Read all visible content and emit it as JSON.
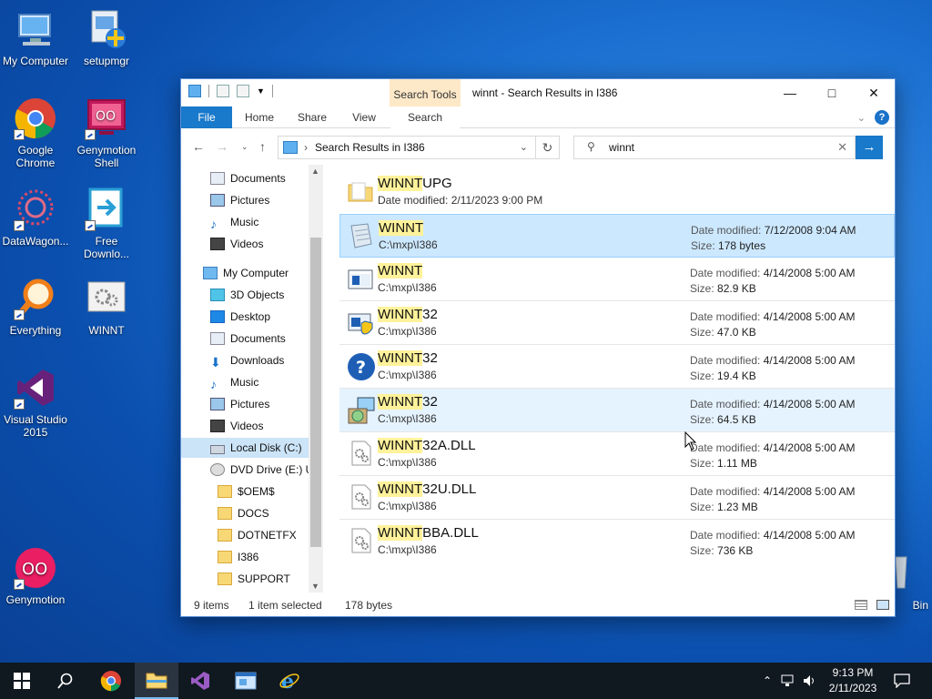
{
  "desktop": {
    "icons": [
      {
        "label": "My Computer"
      },
      {
        "label": "setupmgr"
      },
      {
        "label": "Google Chrome"
      },
      {
        "label": "Genymotion Shell"
      },
      {
        "label": "DataWagon..."
      },
      {
        "label": "Free Downlo..."
      },
      {
        "label": "Everything"
      },
      {
        "label": "WINNT"
      },
      {
        "label": "Visual Studio 2015"
      },
      {
        "label": "Genymotion"
      },
      {
        "label": "Bin"
      }
    ]
  },
  "window": {
    "title": "winnt - Search Results in I386",
    "contextual_tab": "Search Tools",
    "ribbon_tabs": [
      "File",
      "Home",
      "Share",
      "View",
      "Search"
    ],
    "address": {
      "crumb": "Search Results in I386"
    },
    "search": {
      "value": "winnt"
    },
    "nav": [
      {
        "label": "Documents",
        "pinned": true
      },
      {
        "label": "Pictures",
        "pinned": true
      },
      {
        "label": "Music"
      },
      {
        "label": "Videos"
      },
      {
        "label": "My Computer"
      },
      {
        "label": "3D Objects"
      },
      {
        "label": "Desktop"
      },
      {
        "label": "Documents"
      },
      {
        "label": "Downloads"
      },
      {
        "label": "Music"
      },
      {
        "label": "Pictures"
      },
      {
        "label": "Videos"
      },
      {
        "label": "Local Disk (C:)"
      },
      {
        "label": "DVD Drive (E:) UI"
      },
      {
        "label": "$OEM$"
      },
      {
        "label": "DOCS"
      },
      {
        "label": "DOTNETFX"
      },
      {
        "label": "I386"
      },
      {
        "label": "SUPPORT"
      }
    ],
    "results": [
      {
        "hl": "WINNT",
        "rest": "UPG",
        "line2": "Date modified: 2/11/2023 9:00 PM",
        "mod_label": "",
        "mod": "",
        "size_label": "",
        "size": ""
      },
      {
        "hl": "WINNT",
        "rest": "",
        "line2": "C:\\mxp\\I386",
        "mod_label": "Date modified:",
        "mod": "7/12/2008 9:04 AM",
        "size_label": "Size:",
        "size": "178 bytes"
      },
      {
        "hl": "WINNT",
        "rest": "",
        "line2": "C:\\mxp\\I386",
        "mod_label": "Date modified:",
        "mod": "4/14/2008 5:00 AM",
        "size_label": "Size:",
        "size": "82.9 KB"
      },
      {
        "hl": "WINNT",
        "rest": "32",
        "line2": "C:\\mxp\\I386",
        "mod_label": "Date modified:",
        "mod": "4/14/2008 5:00 AM",
        "size_label": "Size:",
        "size": "47.0 KB"
      },
      {
        "hl": "WINNT",
        "rest": "32",
        "line2": "C:\\mxp\\I386",
        "mod_label": "Date modified:",
        "mod": "4/14/2008 5:00 AM",
        "size_label": "Size:",
        "size": "19.4 KB"
      },
      {
        "hl": "WINNT",
        "rest": "32",
        "line2": "C:\\mxp\\I386",
        "mod_label": "Date modified:",
        "mod": "4/14/2008 5:00 AM",
        "size_label": "Size:",
        "size": "64.5 KB"
      },
      {
        "hl": "WINNT",
        "rest": "32A.DLL",
        "line2": "C:\\mxp\\I386",
        "mod_label": "Date modified:",
        "mod": "4/14/2008 5:00 AM",
        "size_label": "Size:",
        "size": "1.11 MB"
      },
      {
        "hl": "WINNT",
        "rest": "32U.DLL",
        "line2": "C:\\mxp\\I386",
        "mod_label": "Date modified:",
        "mod": "4/14/2008 5:00 AM",
        "size_label": "Size:",
        "size": "1.23 MB"
      },
      {
        "hl": "WINNT",
        "rest": "BBA.DLL",
        "line2": "C:\\mxp\\I386",
        "mod_label": "Date modified:",
        "mod": "4/14/2008 5:00 AM",
        "size_label": "Size:",
        "size": "736 KB"
      }
    ],
    "status": {
      "items": "9 items",
      "selected": "1 item selected",
      "size": "178 bytes"
    }
  },
  "taskbar": {
    "time": "9:13 PM",
    "date": "2/11/2023"
  }
}
